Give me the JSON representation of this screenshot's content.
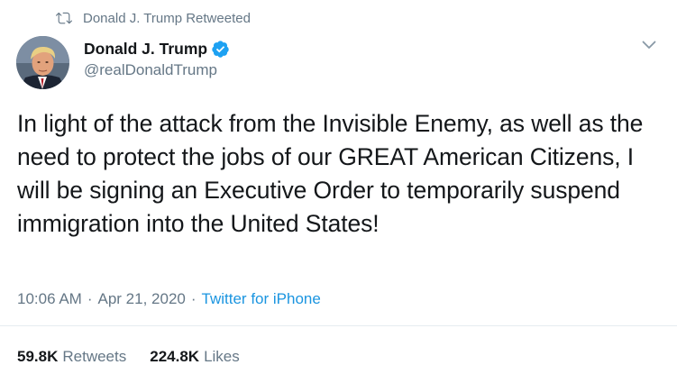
{
  "retweet": {
    "icon": "retweet-icon",
    "label": "Donald J. Trump Retweeted"
  },
  "author": {
    "name": "Donald J. Trump",
    "handle": "@realDonaldTrump",
    "verified_icon": "verified-badge-icon",
    "avatar": "profile-photo"
  },
  "menu_icon": "chevron-down-icon",
  "tweet": {
    "text": "In light of the attack from the Invisible Enemy, as well as the need to protect the jobs of our GREAT American Citizens, I will be signing an Executive Order to temporarily suspend immigration into the United States!"
  },
  "meta": {
    "time": "10:06 AM",
    "separator": "·",
    "date": "Apr 21, 2020",
    "source": "Twitter for iPhone"
  },
  "stats": {
    "retweets_value": "59.8K",
    "retweets_label": "Retweets",
    "likes_value": "224.8K",
    "likes_label": "Likes"
  },
  "colors": {
    "text": "#14171a",
    "secondary": "#657786",
    "accent": "#1b95e0",
    "verified": "#1da1f2",
    "divider": "#e6ecf0"
  }
}
